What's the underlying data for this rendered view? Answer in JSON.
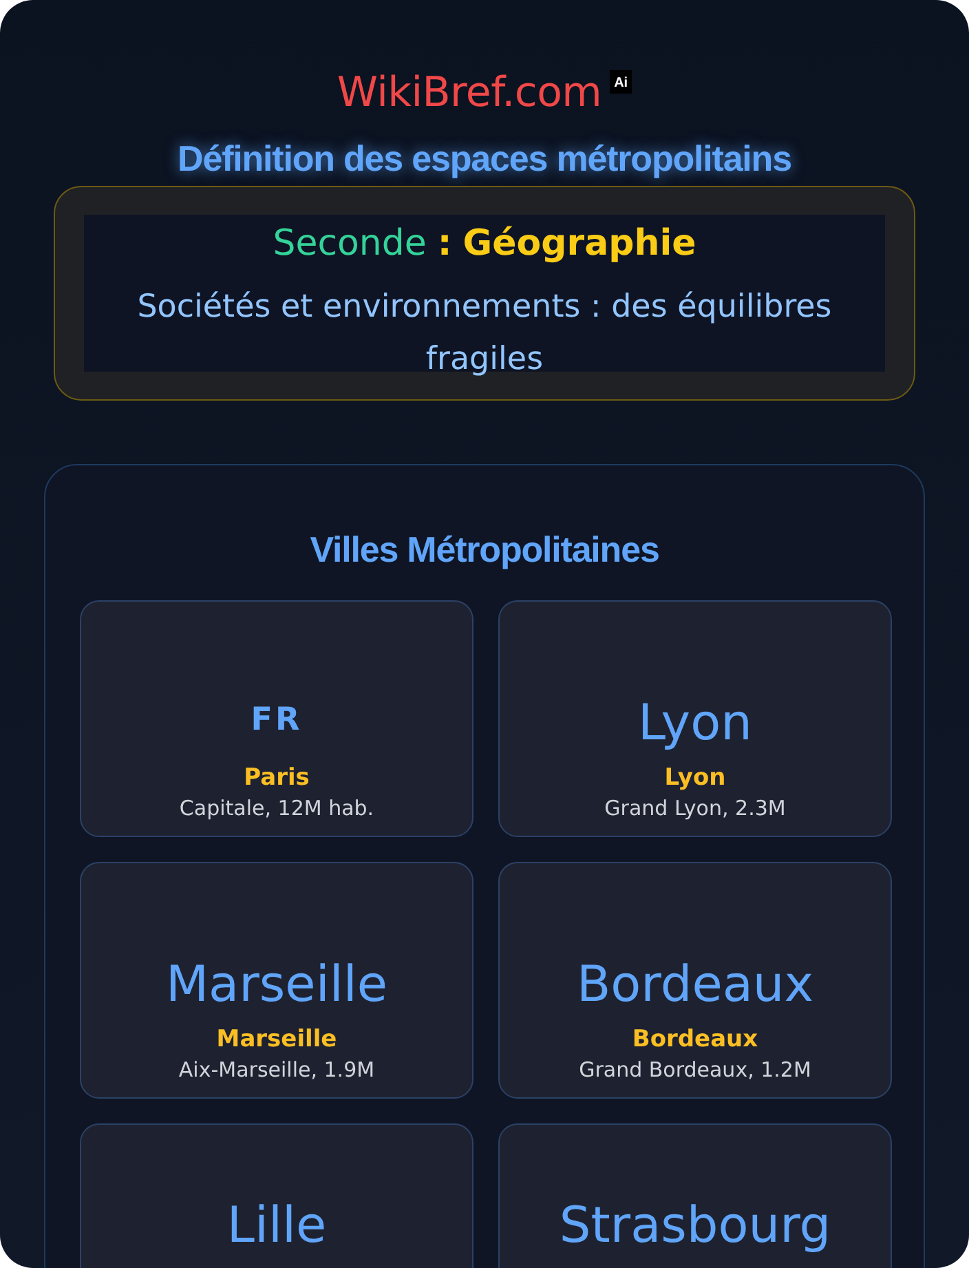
{
  "logo": {
    "text": "WikiBref.com",
    "badge": "Ai"
  },
  "title": "Définition des espaces métropolitains",
  "subject": {
    "level": "Seconde",
    "separator": ":",
    "discipline": "Géographie",
    "theme": "Sociétés et environnements : des équilibres fragiles"
  },
  "section": {
    "heading": "Villes Métropolitaines",
    "cards": [
      {
        "kind": "code",
        "visual": "FR",
        "name": "Paris",
        "detail": "Capitale, 12M hab."
      },
      {
        "kind": "word",
        "visual": "Lyon",
        "name": "Lyon",
        "detail": "Grand Lyon, 2.3M"
      },
      {
        "kind": "word",
        "visual": "Marseille",
        "name": "Marseille",
        "detail": "Aix-Marseille, 1.9M"
      },
      {
        "kind": "word",
        "visual": "Bordeaux",
        "name": "Bordeaux",
        "detail": "Grand Bordeaux, 1.2M"
      },
      {
        "kind": "word",
        "visual": "Lille"
      },
      {
        "kind": "word",
        "visual": "Strasbourg"
      }
    ]
  }
}
